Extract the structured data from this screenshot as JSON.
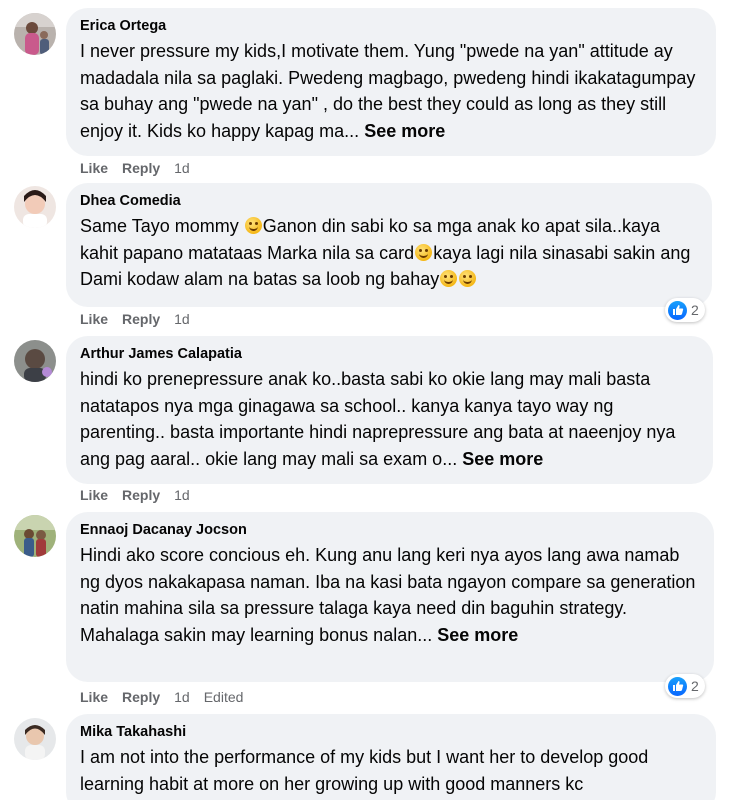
{
  "comments": [
    {
      "author": "Erica Ortega",
      "text": "I never pressure my kids,I motivate them. Yung \"pwede na yan\" attitude ay madadala nila sa paglaki. Pwedeng magbago, pwedeng hindi ikakatagumpay sa buhay ang \"pwede na yan\" , do the best they could as long as they still enjoy it. Kids ko happy kapag ma...",
      "see_more": "See more",
      "like": "Like",
      "reply": "Reply",
      "time": "1d"
    },
    {
      "author": "Dhea Comedia",
      "text_1": "Same Tayo mommy",
      "text_2": "Ganon din sabi ko sa mga anak ko apat sila..kaya kahit papano matataas Marka nila sa card",
      "text_3": "kaya lagi nila sinasabi sakin ang Dami kodaw alam na batas sa loob ng bahay",
      "emoji": "grinning-face-emoji",
      "like": "Like",
      "reply": "Reply",
      "time": "1d",
      "reaction_count": "2",
      "reaction_icon": "like-icon"
    },
    {
      "author": "Arthur James Calapatia",
      "text": "hindi ko prenepressure anak ko..basta sabi ko okie lang may mali basta natatapos nya mga ginagawa sa school.. kanya kanya tayo way ng parenting.. basta importante hindi naprepressure ang bata at naeenjoy nya ang pag aaral.. okie lang may mali sa exam o...",
      "see_more": "See more",
      "like": "Like",
      "reply": "Reply",
      "time": "1d"
    },
    {
      "author": "Ennaoj Dacanay Jocson",
      "text": "Hindi ako score concious eh. Kung anu lang keri nya ayos lang awa namab ng dyos nakakapasa naman. Iba na kasi bata ngayon compare sa generation natin mahina sila sa pressure talaga kaya need din baguhin strategy. Mahalaga sakin may learning bonus nalan...",
      "see_more": "See more",
      "like": "Like",
      "reply": "Reply",
      "time": "1d",
      "edited": "Edited",
      "reaction_count": "2",
      "reaction_icon": "like-icon"
    },
    {
      "author": "Mika Takahashi",
      "text": "I am not into the performance of my kids but I want her to develop good learning habit at more on her growing up with good manners kc"
    }
  ],
  "colors": {
    "bubble": "#f0f2f5",
    "text": "#050505",
    "secondary": "#65676b",
    "like_blue": "#0866ff"
  }
}
